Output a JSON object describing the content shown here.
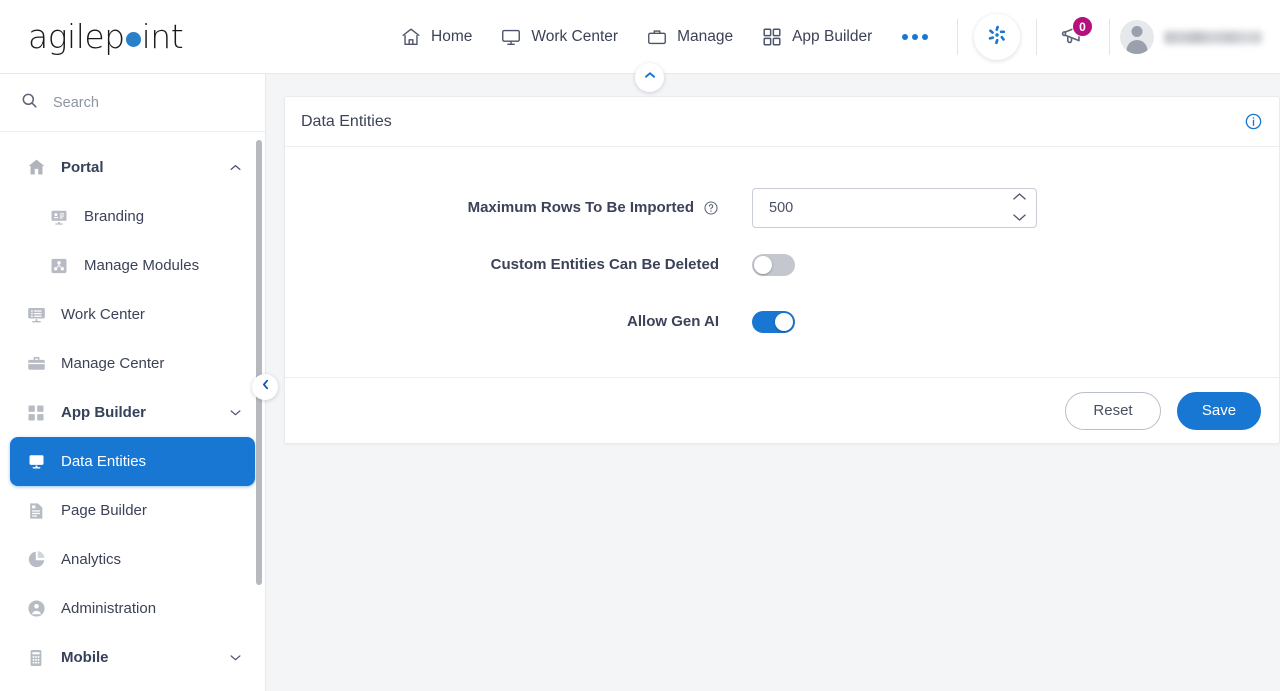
{
  "brand": {
    "logo_part1": "agilep",
    "logo_dot": "o",
    "logo_part2": "int",
    "accent_color": "#1877d2",
    "logo_dot_color": "#2a7fc9",
    "badge_color": "#b5117e"
  },
  "topnav": {
    "items": [
      {
        "label": "Home",
        "icon": "home-icon"
      },
      {
        "label": "Work Center",
        "icon": "monitor-icon"
      },
      {
        "label": "Manage",
        "icon": "briefcase-icon"
      },
      {
        "label": "App Builder",
        "icon": "grid-icon"
      }
    ],
    "more_label": "More",
    "ai_assistant_label": "AI Assistant",
    "announcements_label": "Announcements",
    "announcements_count": "0",
    "user_name": ""
  },
  "header_collapse": {
    "icon": "chevron-up-icon",
    "label": "Collapse Header"
  },
  "sidebar": {
    "search": {
      "placeholder": "Search",
      "value": "",
      "icon": "search-icon"
    },
    "collapse_label": "Collapse Sidebar",
    "items": [
      {
        "label": "Portal",
        "icon": "home-filled-icon",
        "level": "top",
        "expanded": true,
        "chevron": "chevron-up-icon",
        "active": false
      },
      {
        "label": "Branding",
        "icon": "branding-icon",
        "level": "sub",
        "active": false
      },
      {
        "label": "Manage Modules",
        "icon": "modules-icon",
        "level": "sub",
        "active": false
      },
      {
        "label": "Work Center",
        "icon": "worklist-icon",
        "level": "top",
        "active": false
      },
      {
        "label": "Manage Center",
        "icon": "briefcase-icon",
        "level": "top",
        "active": false
      },
      {
        "label": "App Builder",
        "icon": "grid-icon",
        "level": "top",
        "expanded": false,
        "chevron": "chevron-down-icon",
        "active": false
      },
      {
        "label": "Data Entities",
        "icon": "data-entities-icon",
        "level": "top",
        "active": true
      },
      {
        "label": "Page Builder",
        "icon": "page-builder-icon",
        "level": "top",
        "active": false
      },
      {
        "label": "Analytics",
        "icon": "pie-chart-icon",
        "level": "top",
        "active": false
      },
      {
        "label": "Administration",
        "icon": "admin-user-icon",
        "level": "top",
        "active": false
      },
      {
        "label": "Mobile",
        "icon": "mobile-icon",
        "level": "top",
        "expanded": false,
        "chevron": "chevron-down-icon",
        "active": false
      }
    ]
  },
  "panel": {
    "title": "Data Entities",
    "info_label": "Information",
    "fields": {
      "max_rows": {
        "label": "Maximum Rows To Be Imported",
        "value": "500",
        "help_label": "Help",
        "stepper_up": "increase",
        "stepper_down": "decrease"
      },
      "custom_entities_deleted": {
        "label": "Custom Entities Can Be Deleted",
        "state": "off"
      },
      "allow_gen_ai": {
        "label": "Allow Gen AI",
        "state": "on"
      }
    },
    "footer": {
      "reset_label": "Reset",
      "save_label": "Save"
    }
  }
}
